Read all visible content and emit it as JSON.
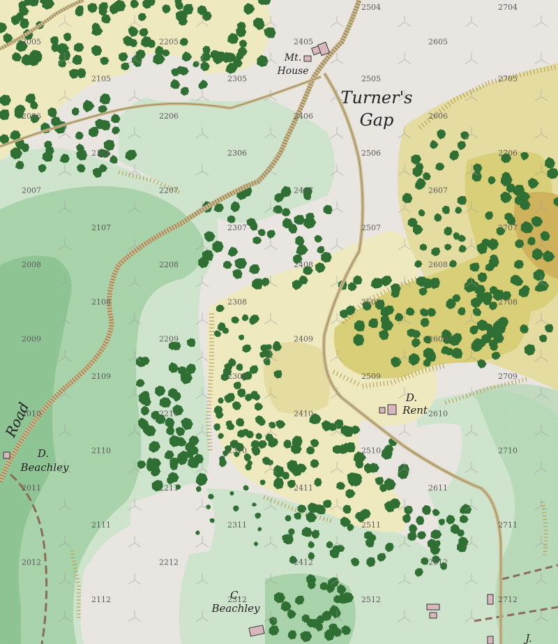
{
  "map": {
    "colors": {
      "clear": "#e9e6e2",
      "light_green": "#cfe4cc",
      "mid_green": "#a9d3aa",
      "dark_green": "#8fc594",
      "cream": "#efe9c0",
      "olive": "#d9cf78",
      "ochre": "#cfb35c",
      "tree": "#2f6f33",
      "road": "#c9b98d",
      "slope": "#b6a35a"
    },
    "place_labels": {
      "mt_house_1": "Mt.",
      "mt_house_2": "House",
      "turners_1": "Turner's",
      "turners_2": "Gap",
      "d_beachley_1": "D.",
      "d_beachley_2": "Beachley",
      "d_rent_1": "D.",
      "d_rent_2": "Rent",
      "c_beachley_1": "C.",
      "c_beachley_2": "Beachley",
      "j_label": "J.",
      "road": "Road"
    },
    "hex_numbers": [
      {
        "id": "2504",
        "col": 5,
        "row": 0,
        "label": "2504"
      },
      {
        "id": "2704",
        "col": 7,
        "row": 0,
        "label": "2704"
      },
      {
        "id": "2005",
        "col": 0,
        "row": 1,
        "label": "2005"
      },
      {
        "id": "2205",
        "col": 2,
        "row": 1,
        "label": "2205"
      },
      {
        "id": "2405",
        "col": 4,
        "row": 1,
        "label": "2405"
      },
      {
        "id": "2605",
        "col": 6,
        "row": 1,
        "label": "2605"
      },
      {
        "id": "2105",
        "col": 1,
        "row": 2,
        "label": "2105"
      },
      {
        "id": "2305",
        "col": 3,
        "row": 2,
        "label": "2305"
      },
      {
        "id": "2505",
        "col": 5,
        "row": 2,
        "label": "2505"
      },
      {
        "id": "2705",
        "col": 7,
        "row": 2,
        "label": "2705"
      },
      {
        "id": "2006",
        "col": 0,
        "row": 3,
        "label": "2006"
      },
      {
        "id": "2206",
        "col": 2,
        "row": 3,
        "label": "2206"
      },
      {
        "id": "2406",
        "col": 4,
        "row": 3,
        "label": "2406"
      },
      {
        "id": "2606",
        "col": 6,
        "row": 3,
        "label": "2606"
      },
      {
        "id": "2106",
        "col": 1,
        "row": 4,
        "label": "2106"
      },
      {
        "id": "2306",
        "col": 3,
        "row": 4,
        "label": "2306"
      },
      {
        "id": "2506",
        "col": 5,
        "row": 4,
        "label": "2506"
      },
      {
        "id": "2706",
        "col": 7,
        "row": 4,
        "label": "2706"
      },
      {
        "id": "2007",
        "col": 0,
        "row": 5,
        "label": "2007"
      },
      {
        "id": "2207",
        "col": 2,
        "row": 5,
        "label": "2207"
      },
      {
        "id": "2407",
        "col": 4,
        "row": 5,
        "label": "2407"
      },
      {
        "id": "2607",
        "col": 6,
        "row": 5,
        "label": "2607"
      },
      {
        "id": "2107",
        "col": 1,
        "row": 6,
        "label": "2107"
      },
      {
        "id": "2307",
        "col": 3,
        "row": 6,
        "label": "2307"
      },
      {
        "id": "2507",
        "col": 5,
        "row": 6,
        "label": "2507"
      },
      {
        "id": "2707",
        "col": 7,
        "row": 6,
        "label": "2707"
      },
      {
        "id": "2008",
        "col": 0,
        "row": 7,
        "label": "2008"
      },
      {
        "id": "2208",
        "col": 2,
        "row": 7,
        "label": "2208"
      },
      {
        "id": "2408",
        "col": 4,
        "row": 7,
        "label": "2408"
      },
      {
        "id": "2608",
        "col": 6,
        "row": 7,
        "label": "2608"
      },
      {
        "id": "2108",
        "col": 1,
        "row": 8,
        "label": "2108"
      },
      {
        "id": "2308",
        "col": 3,
        "row": 8,
        "label": "2308"
      },
      {
        "id": "2508",
        "col": 5,
        "row": 8,
        "label": "2508"
      },
      {
        "id": "2708",
        "col": 7,
        "row": 8,
        "label": "2708"
      },
      {
        "id": "2009",
        "col": 0,
        "row": 9,
        "label": "2009"
      },
      {
        "id": "2209",
        "col": 2,
        "row": 9,
        "label": "2209"
      },
      {
        "id": "2409",
        "col": 4,
        "row": 9,
        "label": "2409"
      },
      {
        "id": "2609",
        "col": 6,
        "row": 9,
        "label": "2609"
      },
      {
        "id": "2109",
        "col": 1,
        "row": 10,
        "label": "2109"
      },
      {
        "id": "2309",
        "col": 3,
        "row": 10,
        "label": "2309"
      },
      {
        "id": "2509",
        "col": 5,
        "row": 10,
        "label": "2509"
      },
      {
        "id": "2709",
        "col": 7,
        "row": 10,
        "label": "2709"
      },
      {
        "id": "2010",
        "col": 0,
        "row": 11,
        "label": "2010"
      },
      {
        "id": "2210",
        "col": 2,
        "row": 11,
        "label": "2210"
      },
      {
        "id": "2410",
        "col": 4,
        "row": 11,
        "label": "2410"
      },
      {
        "id": "2610",
        "col": 6,
        "row": 11,
        "label": "2610"
      },
      {
        "id": "2110",
        "col": 1,
        "row": 12,
        "label": "2110"
      },
      {
        "id": "2310",
        "col": 3,
        "row": 12,
        "label": "2310"
      },
      {
        "id": "2510",
        "col": 5,
        "row": 12,
        "label": "2510"
      },
      {
        "id": "2710",
        "col": 7,
        "row": 12,
        "label": "2710"
      },
      {
        "id": "2011",
        "col": 0,
        "row": 13,
        "label": "2011"
      },
      {
        "id": "2211",
        "col": 2,
        "row": 13,
        "label": "2211"
      },
      {
        "id": "2411",
        "col": 4,
        "row": 13,
        "label": "2411"
      },
      {
        "id": "2611",
        "col": 6,
        "row": 13,
        "label": "2611"
      },
      {
        "id": "2111",
        "col": 1,
        "row": 14,
        "label": "2111"
      },
      {
        "id": "2311",
        "col": 3,
        "row": 14,
        "label": "2311"
      },
      {
        "id": "2511",
        "col": 5,
        "row": 14,
        "label": "2511"
      },
      {
        "id": "2711",
        "col": 7,
        "row": 14,
        "label": "2711"
      },
      {
        "id": "2012",
        "col": 0,
        "row": 15,
        "label": "2012"
      },
      {
        "id": "2212",
        "col": 2,
        "row": 15,
        "label": "2212"
      },
      {
        "id": "2412",
        "col": 4,
        "row": 15,
        "label": "2412"
      },
      {
        "id": "2612",
        "col": 6,
        "row": 15,
        "label": "2612"
      },
      {
        "id": "2112",
        "col": 1,
        "row": 16,
        "label": "2112"
      },
      {
        "id": "2312",
        "col": 3,
        "row": 16,
        "label": "2312"
      },
      {
        "id": "2512",
        "col": 5,
        "row": 16,
        "label": "2512"
      },
      {
        "id": "2712",
        "col": 7,
        "row": 16,
        "label": "2712"
      }
    ]
  }
}
